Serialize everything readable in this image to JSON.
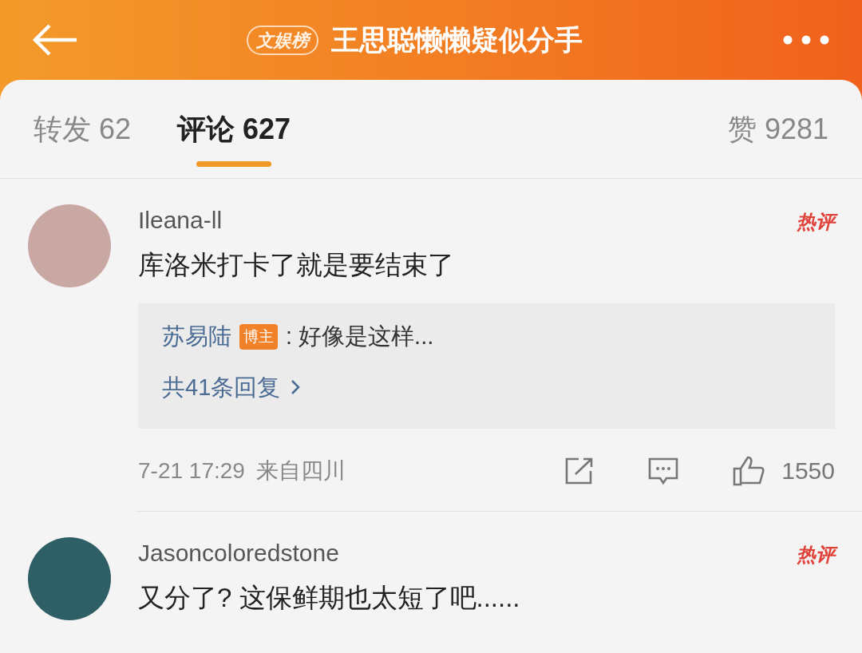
{
  "header": {
    "badge": "文娱榜",
    "title": "王思聪懒懒疑似分手"
  },
  "tabs": [
    {
      "label": "转发 62",
      "selected": false
    },
    {
      "label": "评论 627",
      "selected": true
    }
  ],
  "likes": "赞 9281",
  "comments": [
    {
      "user": "Ileana-ll",
      "tag": "热评",
      "text": "库洛米打卡了就是要结束了",
      "reply": {
        "user": "苏易陆",
        "role": "博主",
        "text": ": 好像是这样...",
        "more": "共41条回复"
      },
      "time": "7-21 17:29",
      "location": "来自四川",
      "like_count": "1550"
    },
    {
      "user": "Jasoncoloredstone",
      "tag": "热评",
      "text": "又分了? 这保鲜期也太短了吧......"
    }
  ]
}
